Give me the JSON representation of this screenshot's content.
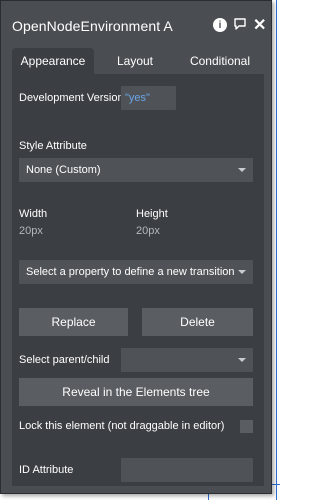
{
  "window": {
    "title": "OpenNodeEnvironment A"
  },
  "icons": {
    "info": "info-icon",
    "comment": "comment-icon",
    "close": "close-icon"
  },
  "tabs": [
    {
      "label": "Appearance",
      "active": true
    },
    {
      "label": "Layout",
      "active": false
    },
    {
      "label": "Conditional",
      "active": false
    }
  ],
  "dev_version": {
    "label": "Development Version",
    "value": "\"yes\""
  },
  "style": {
    "label": "Style Attribute",
    "value": "None (Custom)"
  },
  "size": {
    "width_label": "Width",
    "width_value": "20px",
    "height_label": "Height",
    "height_value": "20px"
  },
  "transition": {
    "placeholder": "Select a property to define a new transition"
  },
  "actions": {
    "replace_label": "Replace",
    "delete_label": "Delete"
  },
  "parent_child": {
    "label": "Select parent/child",
    "value": ""
  },
  "reveal": {
    "label": "Reveal in the Elements tree"
  },
  "lock": {
    "label": "Lock this element (not draggable in editor)",
    "checked": false
  },
  "id_attr": {
    "label": "ID Attribute",
    "value": ""
  },
  "colors": {
    "panel": "#4a4e52",
    "body": "#3b3e42",
    "accent_text": "#6aa6e8"
  }
}
